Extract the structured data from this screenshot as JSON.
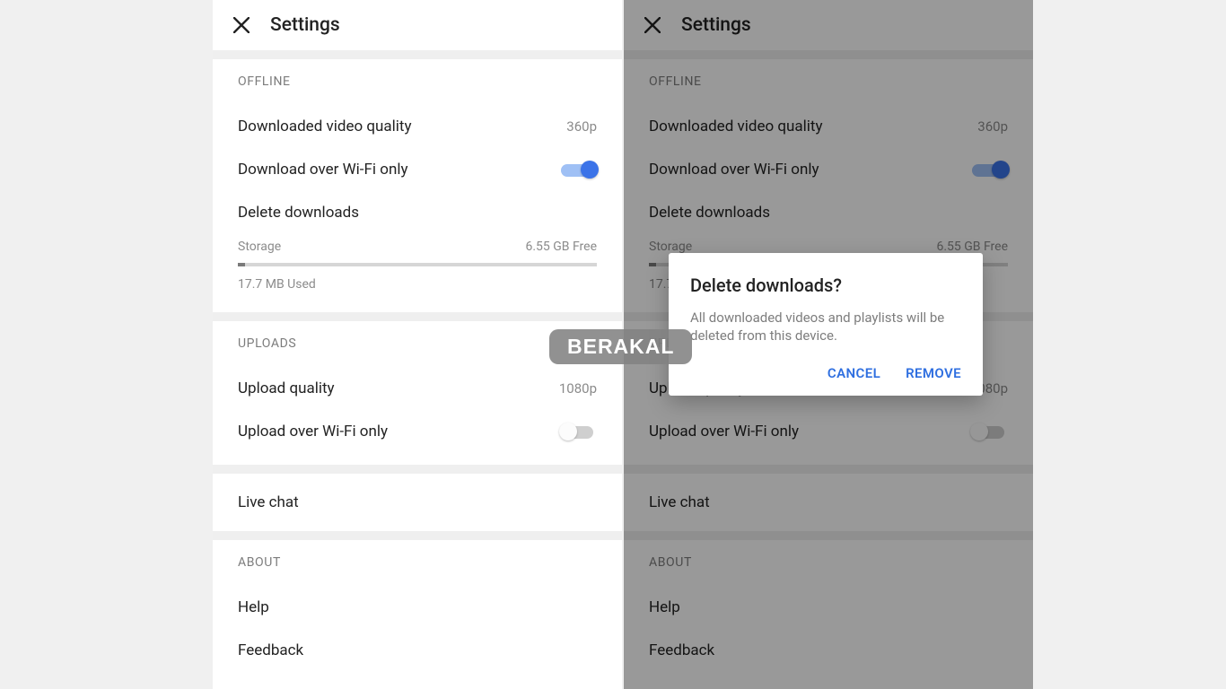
{
  "header": {
    "title": "Settings"
  },
  "sections": {
    "offline": {
      "label": "OFFLINE",
      "downloaded_quality": {
        "label": "Downloaded video quality",
        "value": "360p"
      },
      "wifi_only": {
        "label": "Download over Wi-Fi only",
        "on": true
      },
      "delete_downloads": {
        "label": "Delete downloads"
      },
      "storage": {
        "label": "Storage",
        "free": "6.55 GB Free",
        "used": "17.7 MB Used"
      }
    },
    "uploads": {
      "label": "UPLOADS",
      "upload_quality": {
        "label": "Upload quality",
        "value": "1080p"
      },
      "wifi_only": {
        "label": "Upload over Wi-Fi only",
        "on": false
      }
    },
    "live_chat": {
      "label": "Live chat"
    },
    "about": {
      "label": "ABOUT",
      "help": "Help",
      "feedback": "Feedback"
    }
  },
  "dialog": {
    "title": "Delete downloads?",
    "body": "All downloaded videos and playlists will be deleted from this device.",
    "cancel": "CANCEL",
    "remove": "REMOVE"
  },
  "watermark": "BERAKAL"
}
